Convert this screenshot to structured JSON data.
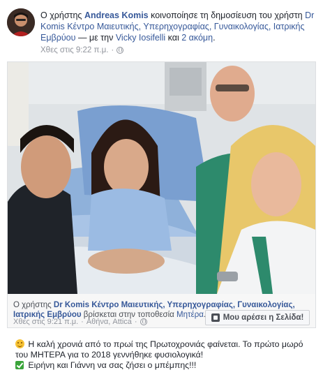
{
  "header": {
    "prefix": "Ο χρήστης",
    "author": "Andreas Komis",
    "verb": "κοινοποίησε τη δημοσίευση του χρήστη",
    "page": "Dr Komis Κέντρο Μαιευτικής, Υπερηχογραφίας, Γυναικολογίας, Ιατρικής Εμβρύου",
    "with_sep": "— με την",
    "tagged": "Vicky Iosifelli",
    "and": "και",
    "others": "2 ακόμη",
    "end": ".",
    "time": "Χθες στις 9:22 π.μ.",
    "dot": "·",
    "privacy_icon": "globe-icon"
  },
  "shared": {
    "caption_prefix": "Ο χρήστης",
    "page": "Dr Komis Κέντρο Μαιευτικής, Υπερηχογραφίας, Γυναικολογίας, Ιατρικής Εμβρύου",
    "caption_mid": "βρίσκεται στην τοποθεσία",
    "place": "Μητέρα",
    "caption_end": ".",
    "time": "Χθες στις 9:21 π.μ.",
    "dot": "·",
    "location": "Αθήνα, Attica",
    "dot2": "·",
    "privacy_icon": "globe-icon",
    "like_button": "Μου αρέσει η Σελίδα!"
  },
  "body": {
    "line1": "Η καλή χρονιά από το πρωί της Πρωτοχρονιάς φαίνεται. Το πρώτο μωρό του ΜΗΤΕΡΑ για το 2018 γεννήθηκε φυσιολογικά!",
    "line2": "Ειρήνη και Γιάννη να σας ζήσει ο μπέμπης!!!"
  },
  "colors": {
    "link": "#365899",
    "meta": "#90949c",
    "text": "#1d2129"
  }
}
